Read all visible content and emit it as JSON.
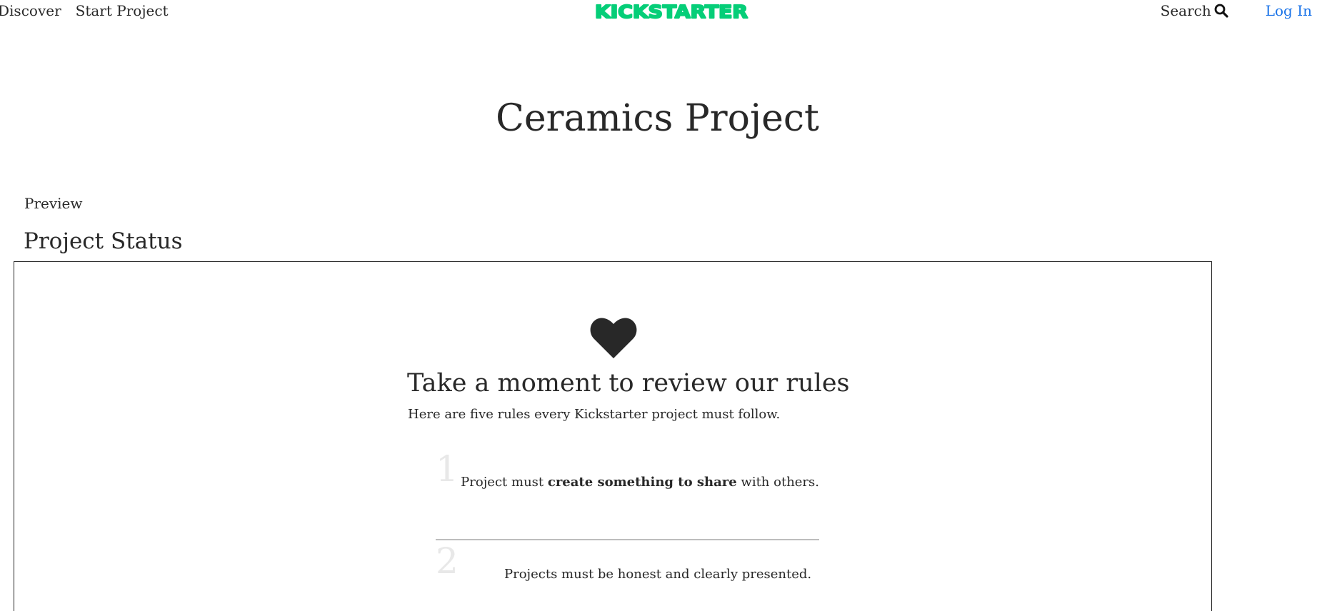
{
  "header": {
    "nav": [
      "Discover",
      "Start Project"
    ],
    "logo_text": "KICKSTARTER",
    "search_label": "Search",
    "login_label": "Log In"
  },
  "page": {
    "title": "Ceramics Project",
    "preview_label": "Preview",
    "status_heading": "Project Status"
  },
  "rules": {
    "heading": "Take a moment to review our rules",
    "subheading": "Here are five rules every Kickstarter project must follow.",
    "items": [
      {
        "number": "1",
        "text_before": "Project must ",
        "text_bold": "create something to share",
        "text_after": " with others."
      },
      {
        "number": "2",
        "text_before": "Projects must be honest and clearly presented.",
        "text_bold": "",
        "text_after": ""
      }
    ]
  },
  "colors": {
    "brand_green": "#05ce78",
    "link_blue": "#1a73e8",
    "text": "#282828",
    "rule_number": "#e8e8e8",
    "divider": "#bdbdbd"
  },
  "icons": {
    "search": "search-icon",
    "heart": "heart-icon"
  }
}
